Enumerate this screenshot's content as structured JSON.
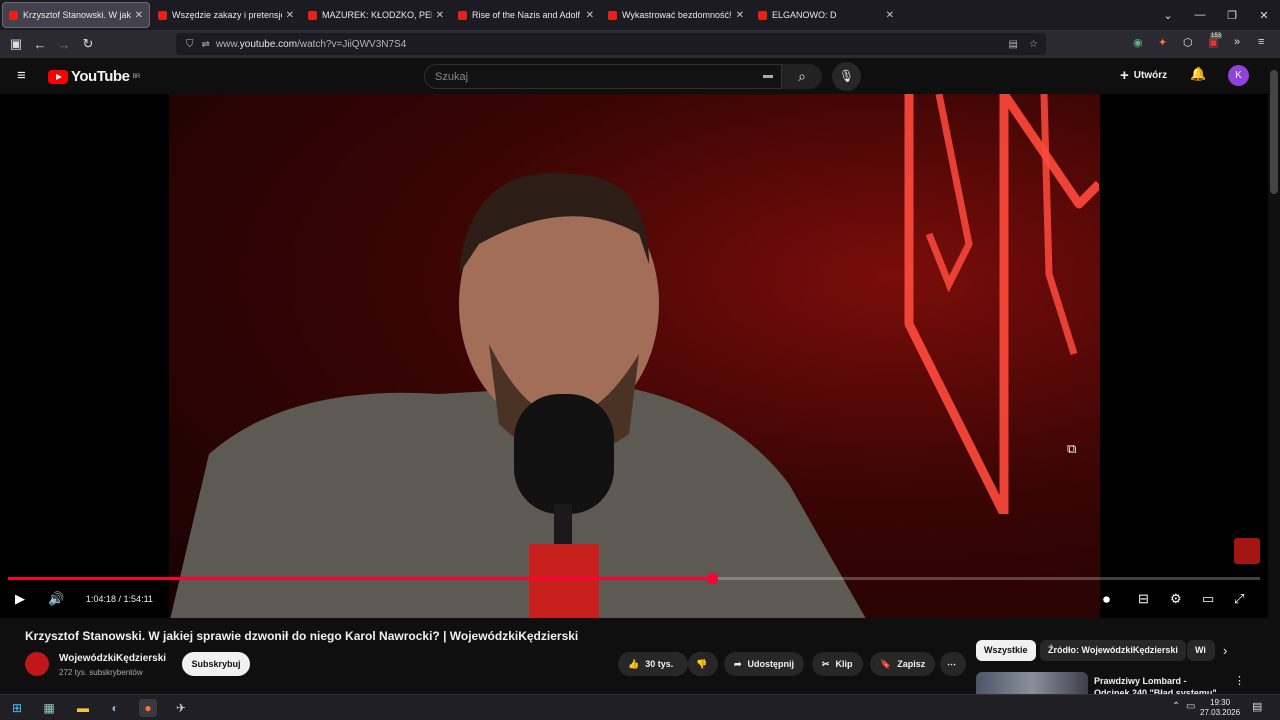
{
  "browser": {
    "tabs": [
      {
        "title": "Krzysztof Stanowski. W jakiej sp",
        "active": true
      },
      {
        "title": "Wszędzie zakazy i pretensje! Lu",
        "active": false
      },
      {
        "title": "MAZUREK: KŁODZKO, PEDOFILI",
        "active": false
      },
      {
        "title": "Rise of the Nazis and Adolf Hitl",
        "active": false
      },
      {
        "title": "Wykastrować bezdomność! Ust",
        "active": false
      },
      {
        "title": "ELGANOWO: D",
        "active": false
      }
    ],
    "url_prefix": "www.",
    "url_host": "youtube.com",
    "url_path": "/watch?v=JiiQWV3N7S4",
    "ext_badge": "153"
  },
  "youtube": {
    "logo_text": "YouTube",
    "logo_region": "BR",
    "search_placeholder": "Szukaj",
    "create_label": "Utwórz",
    "avatar_letter": "K"
  },
  "player": {
    "current_time": "1:04:18",
    "total_time": "1:54:11",
    "time_separator": " / ",
    "progress_fraction": 0.562
  },
  "video": {
    "title": "Krzysztof Stanowski. W jakiej sprawie dzwonił do niego Karol Nawrocki? | WojewódzkiKędzierski",
    "channel_name": "WojewódzkiKędzierski",
    "subscribers": "272 tys. subskrybentów",
    "subscribe_label": "Subskrybuj",
    "likes": "30 tys.",
    "share_label": "Udostępnij",
    "clip_label": "Klip",
    "save_label": "Zapisz"
  },
  "sidebar": {
    "chips": [
      "Wszystkie",
      "Źródło: WojewódzkiKędzierski",
      "Wi"
    ],
    "rec_title": "Prawdziwy Lombard - Odcinek 240 \"Błąd systemu\""
  },
  "taskbar": {
    "time": "19:30",
    "date": "27.03.2026"
  },
  "colors": {
    "yt_red": "#ff0000",
    "progress": "#ff0033",
    "avatar": "#8e44d6"
  }
}
